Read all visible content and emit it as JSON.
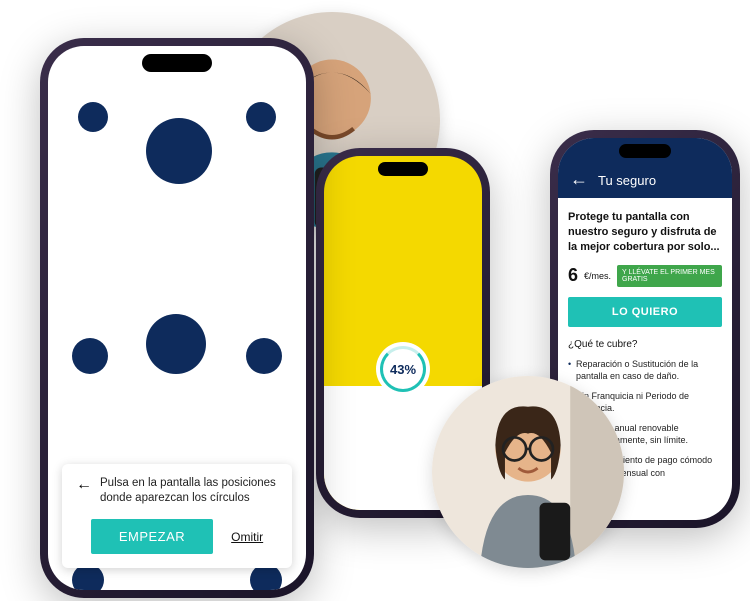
{
  "colors": {
    "navy": "#0e2b5c",
    "teal": "#1fc1b5",
    "yellow": "#f4d900",
    "green": "#3fa64b"
  },
  "phone1": {
    "instruction": "Pulsa en la pantalla las posiciones donde aparezcan los círculos",
    "start_label": "EMPEZAR",
    "skip_label": "Omitir"
  },
  "phone2": {
    "progress_label": "43%",
    "progress_value": 43
  },
  "phone3": {
    "header_title": "Tu seguro",
    "headline": "Protege tu pantalla con nuestro seguro y disfruta de la mejor cobertura por solo...",
    "price": "6",
    "price_suffix": "€/mes.",
    "badge": "Y LLÉVATE EL PRIMER MES GRATIS",
    "cta_label": "LO QUIERO",
    "coverage_heading": "¿Qué te cubre?",
    "features": [
      "Reparación o Sustitución de la pantalla en caso de daño.",
      "Sin Franquicia ni Periodo de Carencia.",
      "Duración anual renovable automáticamente, sin límite.",
      "Fraccionamiento de pago cómodo de forma mensual con"
    ]
  },
  "avatars": {
    "man": "man-with-phone",
    "woman": "woman-with-phone"
  }
}
